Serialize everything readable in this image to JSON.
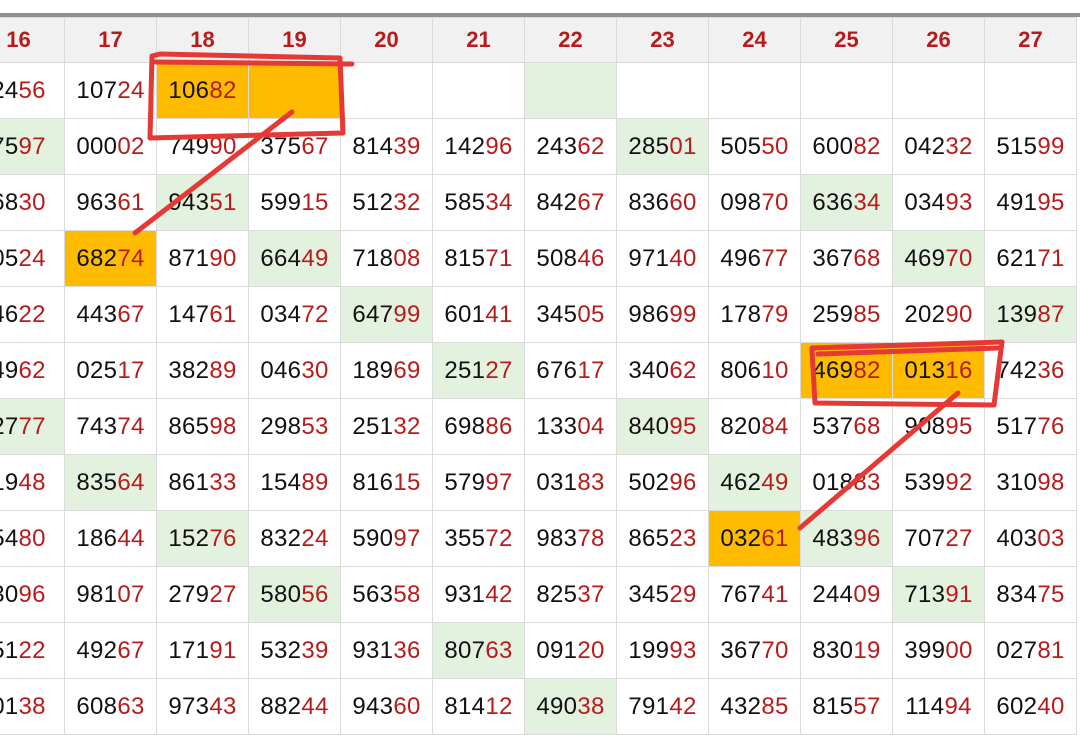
{
  "columns": [
    "16",
    "17",
    "18",
    "19",
    "20",
    "21",
    "22",
    "23",
    "24",
    "25",
    "26",
    "27"
  ],
  "rows": [
    [
      {
        "v": "2456"
      },
      {
        "v": "10724"
      },
      {
        "v": "10682",
        "h": "o"
      },
      {
        "v": "",
        "h": "o"
      },
      {
        "v": ""
      },
      {
        "v": ""
      },
      {
        "v": "",
        "h": "g"
      },
      {
        "v": ""
      },
      {
        "v": ""
      },
      {
        "v": ""
      },
      {
        "v": ""
      },
      {
        "v": ""
      }
    ],
    [
      {
        "v": "7597",
        "h": "g"
      },
      {
        "v": "00002"
      },
      {
        "v": "74990"
      },
      {
        "v": "37567"
      },
      {
        "v": "81439"
      },
      {
        "v": "14296"
      },
      {
        "v": "24362"
      },
      {
        "v": "28501",
        "h": "g"
      },
      {
        "v": "50550"
      },
      {
        "v": "60082"
      },
      {
        "v": "04232"
      },
      {
        "v": "51599"
      }
    ],
    [
      {
        "v": "6830"
      },
      {
        "v": "96361"
      },
      {
        "v": "94351",
        "h": "g"
      },
      {
        "v": "59915"
      },
      {
        "v": "51232"
      },
      {
        "v": "58534"
      },
      {
        "v": "84267"
      },
      {
        "v": "83660"
      },
      {
        "v": "09870"
      },
      {
        "v": "63634",
        "h": "g"
      },
      {
        "v": "03493"
      },
      {
        "v": "49195"
      }
    ],
    [
      {
        "v": "0524"
      },
      {
        "v": "68274",
        "h": "o"
      },
      {
        "v": "87190"
      },
      {
        "v": "66449",
        "h": "g"
      },
      {
        "v": "71808"
      },
      {
        "v": "81571"
      },
      {
        "v": "50846"
      },
      {
        "v": "97140"
      },
      {
        "v": "49677"
      },
      {
        "v": "36768"
      },
      {
        "v": "46970",
        "h": "g"
      },
      {
        "v": "62171"
      }
    ],
    [
      {
        "v": "4622"
      },
      {
        "v": "44367"
      },
      {
        "v": "14761"
      },
      {
        "v": "03472"
      },
      {
        "v": "64799",
        "h": "g"
      },
      {
        "v": "60141"
      },
      {
        "v": "34505"
      },
      {
        "v": "98699"
      },
      {
        "v": "17879"
      },
      {
        "v": "25985"
      },
      {
        "v": "20290"
      },
      {
        "v": "13987",
        "h": "g"
      }
    ],
    [
      {
        "v": "4962"
      },
      {
        "v": "02517"
      },
      {
        "v": "38289"
      },
      {
        "v": "04630"
      },
      {
        "v": "18969"
      },
      {
        "v": "25127",
        "h": "g"
      },
      {
        "v": "67617"
      },
      {
        "v": "34062"
      },
      {
        "v": "80610"
      },
      {
        "v": "46982",
        "h": "o"
      },
      {
        "v": "01316",
        "h": "o"
      },
      {
        "v": "74236"
      }
    ],
    [
      {
        "v": "2777",
        "h": "g"
      },
      {
        "v": "74374"
      },
      {
        "v": "86598"
      },
      {
        "v": "29853"
      },
      {
        "v": "25132"
      },
      {
        "v": "69886"
      },
      {
        "v": "13304"
      },
      {
        "v": "84095",
        "h": "g"
      },
      {
        "v": "82084"
      },
      {
        "v": "53768"
      },
      {
        "v": "90895"
      },
      {
        "v": "51776"
      }
    ],
    [
      {
        "v": "1948"
      },
      {
        "v": "83564",
        "h": "g"
      },
      {
        "v": "86133"
      },
      {
        "v": "15489"
      },
      {
        "v": "81615"
      },
      {
        "v": "57997"
      },
      {
        "v": "03183"
      },
      {
        "v": "50296"
      },
      {
        "v": "46249",
        "h": "g"
      },
      {
        "v": "01883"
      },
      {
        "v": "53992"
      },
      {
        "v": "31098"
      }
    ],
    [
      {
        "v": "5480"
      },
      {
        "v": "18644"
      },
      {
        "v": "15276",
        "h": "g"
      },
      {
        "v": "83224"
      },
      {
        "v": "59097"
      },
      {
        "v": "35572"
      },
      {
        "v": "98378"
      },
      {
        "v": "86523"
      },
      {
        "v": "03261",
        "h": "o"
      },
      {
        "v": "48396",
        "h": "g"
      },
      {
        "v": "70727"
      },
      {
        "v": "40303"
      }
    ],
    [
      {
        "v": "3096"
      },
      {
        "v": "98107"
      },
      {
        "v": "27927"
      },
      {
        "v": "58056",
        "h": "g"
      },
      {
        "v": "56358"
      },
      {
        "v": "93142"
      },
      {
        "v": "82537"
      },
      {
        "v": "34529"
      },
      {
        "v": "76741"
      },
      {
        "v": "24409"
      },
      {
        "v": "71391",
        "h": "g"
      },
      {
        "v": "83475"
      }
    ],
    [
      {
        "v": "5122"
      },
      {
        "v": "49267"
      },
      {
        "v": "17191"
      },
      {
        "v": "53239"
      },
      {
        "v": "93136"
      },
      {
        "v": "80763",
        "h": "g"
      },
      {
        "v": "09120"
      },
      {
        "v": "19993"
      },
      {
        "v": "36770"
      },
      {
        "v": "83019"
      },
      {
        "v": "39900"
      },
      {
        "v": "02781"
      }
    ],
    [
      {
        "v": "0138"
      },
      {
        "v": "60863"
      },
      {
        "v": "97343"
      },
      {
        "v": "88244"
      },
      {
        "v": "94360"
      },
      {
        "v": "81412"
      },
      {
        "v": "49038",
        "h": "g"
      },
      {
        "v": "79142"
      },
      {
        "v": "43285"
      },
      {
        "v": "81557"
      },
      {
        "v": "11494"
      },
      {
        "v": "60240"
      }
    ]
  ],
  "colors": {
    "header_bg": "#f1f1f1",
    "header_text": "#b71c1c",
    "digit_dark": "#111111",
    "digit_red": "#b71c1c",
    "green_cell": "#e3f1df",
    "orange_cell": "#ffbb00",
    "annotation_pen": "#e53935"
  },
  "annotations": [
    {
      "type": "freehand-box",
      "around": "row 1, columns 18–19"
    },
    {
      "type": "freehand-line",
      "from": "row 1, column 19",
      "to": "row 4, column 17"
    },
    {
      "type": "freehand-box",
      "around": "row 6, columns 25–26"
    },
    {
      "type": "freehand-line",
      "from": "row 6, column 26",
      "to": "row 9, column 24"
    }
  ]
}
